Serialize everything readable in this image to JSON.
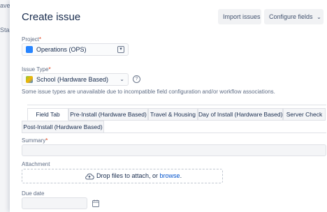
{
  "background": {
    "text1": "ave &e",
    "text2": "Sta"
  },
  "dialog": {
    "title": "Create issue",
    "import_label": "Import issues",
    "configure_label": "Configure fields",
    "project": {
      "label": "Project",
      "required": "*",
      "value": "Operations (OPS)"
    },
    "issue_type": {
      "label": "Issue Type",
      "required": "*",
      "value": "School (Hardware Based)",
      "note": "Some issue types are unavailable due to incompatible field configuration and/or workflow associations."
    },
    "tabs": [
      {
        "label": "Field Tab",
        "active": true
      },
      {
        "label": "Pre-Install (Hardware Based)",
        "active": false
      },
      {
        "label": "Travel & Housing",
        "active": false
      },
      {
        "label": "Day of Install (Hardware Based)",
        "active": false
      },
      {
        "label": "Server Check",
        "active": false
      },
      {
        "label": "Post-Install (Hardware Based)",
        "active": false
      }
    ],
    "summary": {
      "label": "Summary",
      "required": "*",
      "value": ""
    },
    "attachment": {
      "label": "Attachment",
      "drop_text": "Drop files to attach, or ",
      "browse": "browse",
      "period": "."
    },
    "due_date": {
      "label": "Due date",
      "value": ""
    }
  }
}
